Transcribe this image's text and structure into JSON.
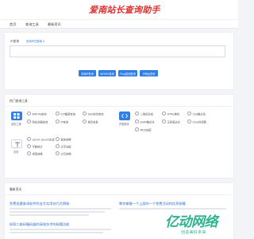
{
  "header": {
    "logo_text": "爱南站长查询助手"
  },
  "nav": {
    "items": [
      "首页",
      "查询工具",
      "最新资讯"
    ]
  },
  "search": {
    "label": "IP查询",
    "hint": "查询IP归属地 ▾",
    "placeholder": "",
    "buttons": [
      "本地IP查询",
      "WHOIS查询",
      "Ping检测查询",
      "IP地址查询"
    ]
  },
  "categories": {
    "title": "热门查询工具",
    "items": [
      {
        "name": "站长工具",
        "icon": "grid-icon",
        "style": "filled"
      },
      {
        "name": "开发助手",
        "icon": "code-icon",
        "style": "filled"
      },
      {
        "name": "文字",
        "icon": "text-icon",
        "style": "outline"
      }
    ],
    "group1": [
      "WHOIS查询",
      "ICP备案查询",
      "SEO综合查询",
      "网站测速查询",
      "IP查询",
      "域名信息"
    ],
    "group2": [
      "二维码生成",
      "HTML美化",
      "CSS格式化",
      "JSON格式化",
      "正则表达式",
      "Unix时间戳",
      "MD5加密"
    ],
    "group3": [
      "Lorem ipsum生成",
      "繁体转换",
      "字数统计",
      "文字加密",
      "拼音转换",
      "大写转换"
    ]
  },
  "news": {
    "title": "最新资讯",
    "items": [
      "免费批量查询软件的五大实用技巧大揭秘",
      "教你掌握一个上面的一个免费活动的信息秘籍",
      "探索二维码编码器的高效技术的秘籍功能"
    ]
  },
  "watermark": {
    "brand": "亿动网络",
    "slogan": "创造美好未来"
  }
}
